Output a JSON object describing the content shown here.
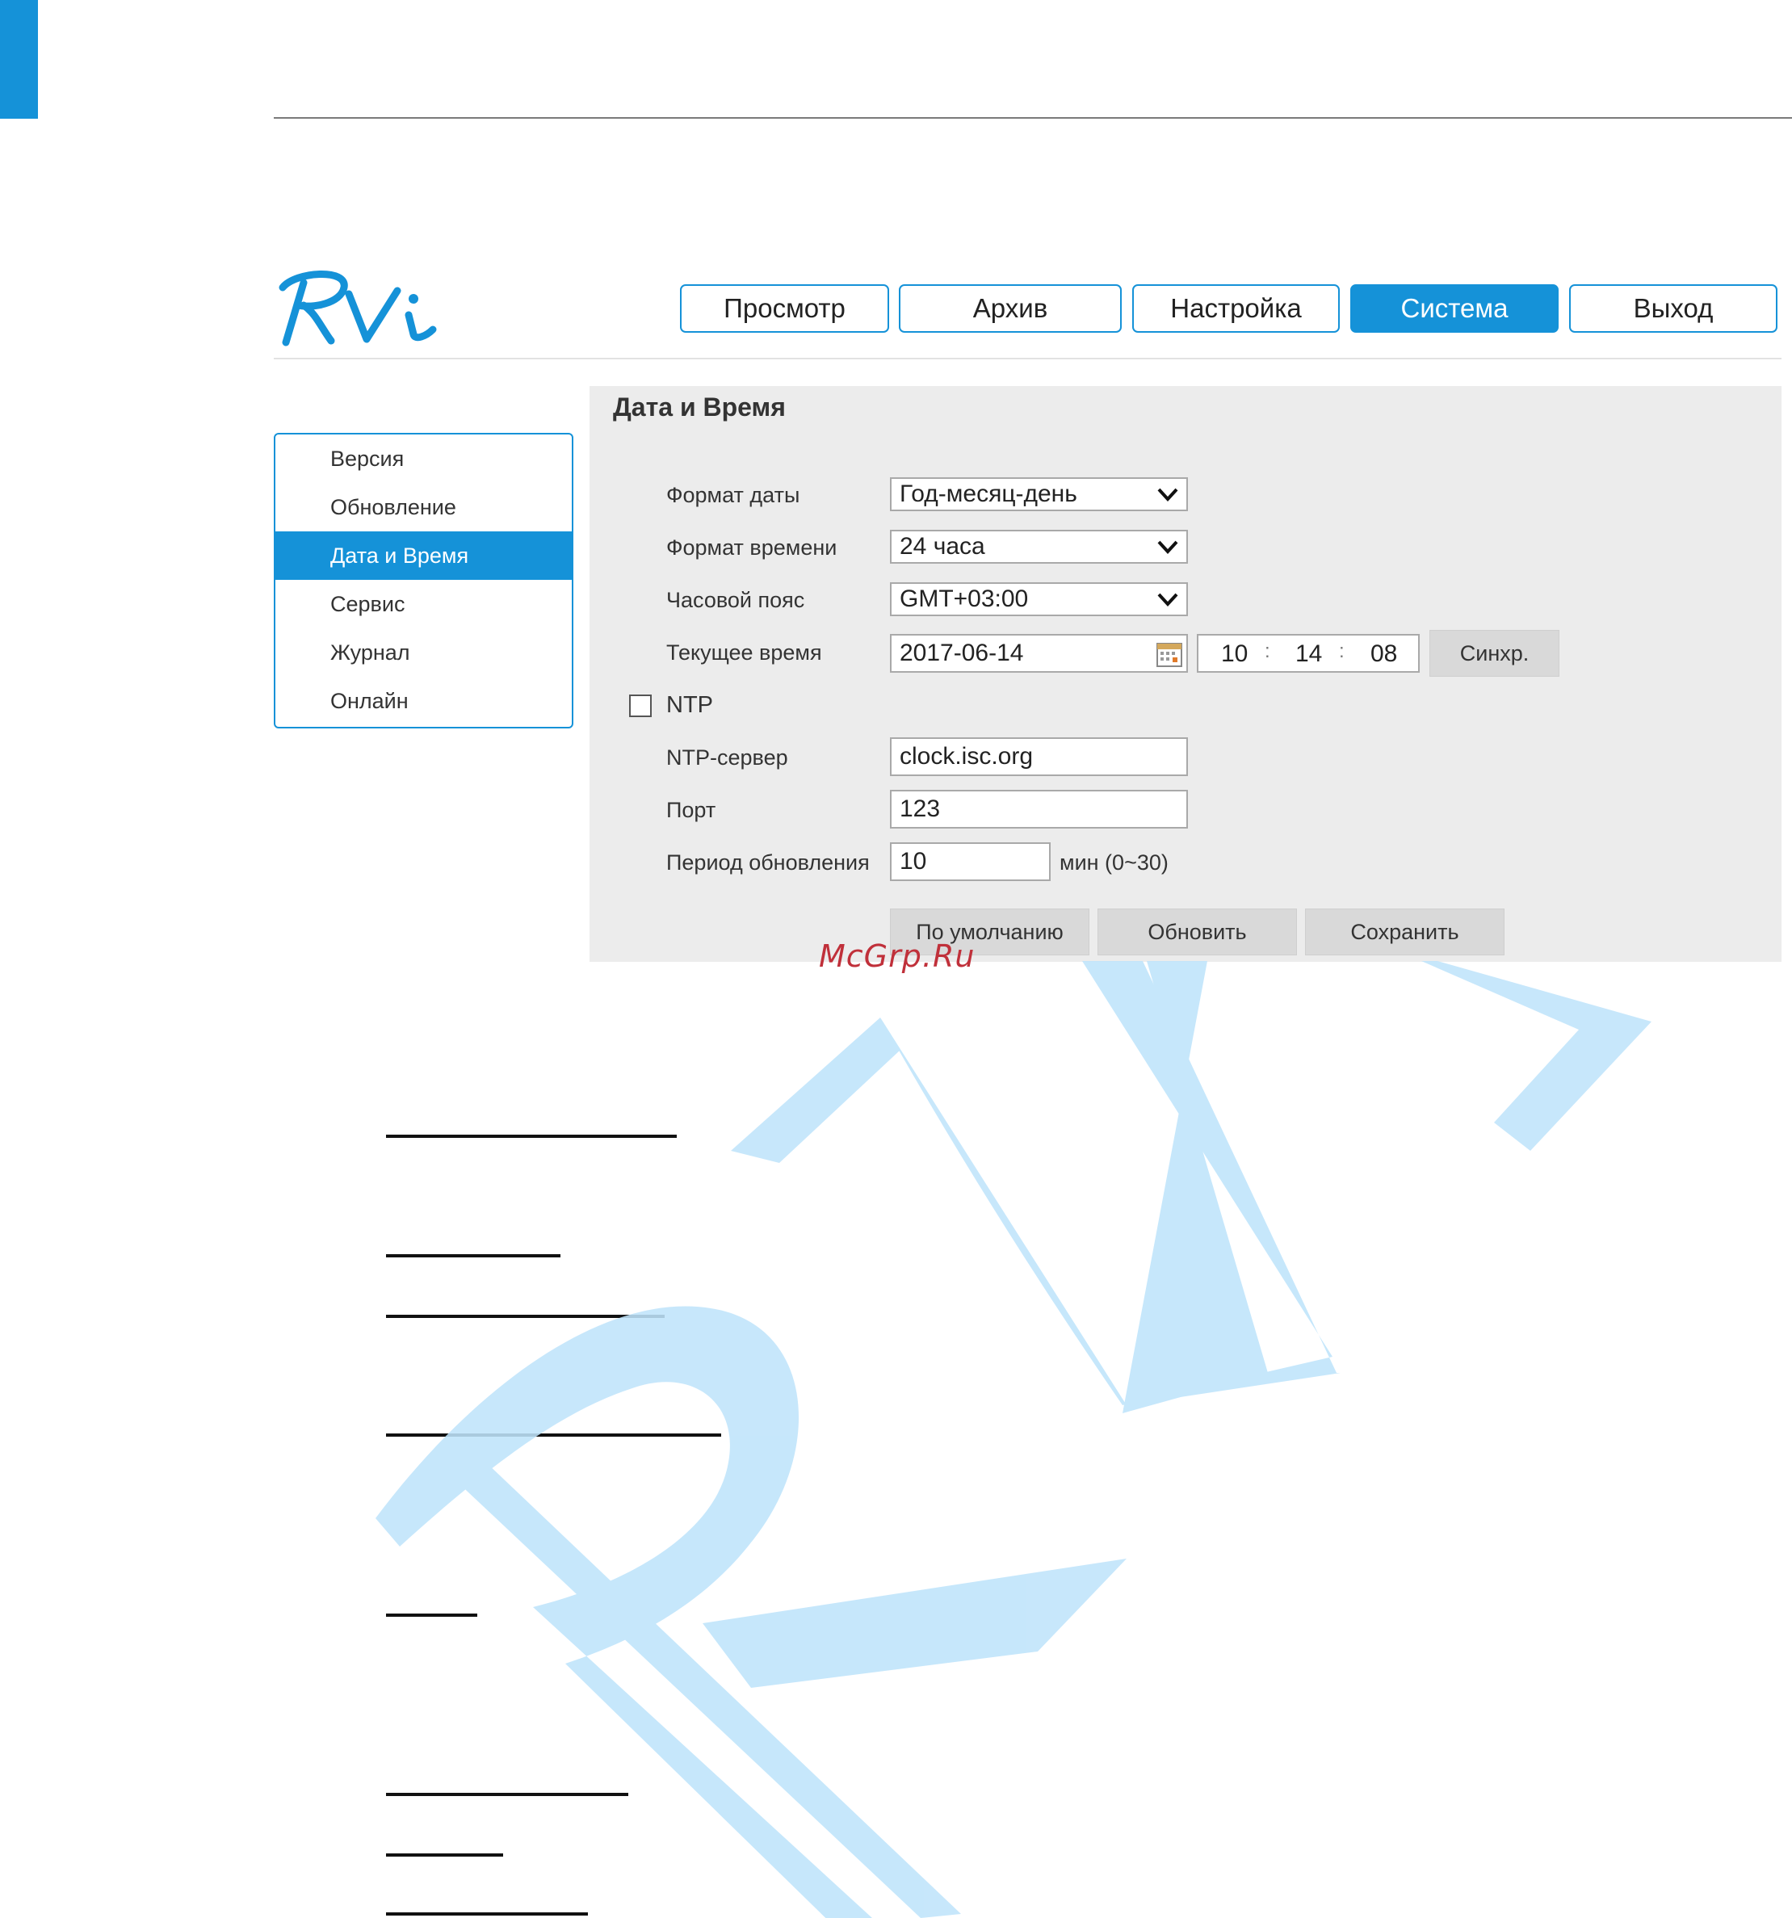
{
  "nav": {
    "tabs": [
      {
        "label": "Просмотр",
        "active": false
      },
      {
        "label": "Архив",
        "active": false
      },
      {
        "label": "Настройка",
        "active": false
      },
      {
        "label": "Система",
        "active": true
      },
      {
        "label": "Выход",
        "active": false
      }
    ]
  },
  "sidebar": {
    "items": [
      {
        "label": "Версия",
        "active": false
      },
      {
        "label": "Обновление",
        "active": false
      },
      {
        "label": "Дата и Время",
        "active": true
      },
      {
        "label": "Сервис",
        "active": false
      },
      {
        "label": "Журнал",
        "active": false
      },
      {
        "label": "Онлайн",
        "active": false
      }
    ]
  },
  "panel": {
    "title": "Дата и Время",
    "date_format": {
      "label": "Формат даты",
      "value": "Год-месяц-день"
    },
    "time_format": {
      "label": "Формат времени",
      "value": "24 часа"
    },
    "timezone": {
      "label": "Часовой пояс",
      "value": "GMT+03:00"
    },
    "current_time": {
      "label": "Текущее время",
      "date": "2017-06-14",
      "hours": "10",
      "minutes": "14",
      "seconds": "08",
      "sep": ":",
      "sync_label": "Синхр."
    },
    "ntp": {
      "label": "NTP",
      "checked": false
    },
    "ntp_server": {
      "label": "NTP-сервер",
      "value": "clock.isc.org"
    },
    "port": {
      "label": "Порт",
      "value": "123"
    },
    "update_period": {
      "label": "Период обновления",
      "value": "10",
      "unit": "мин (0~30)"
    },
    "buttons": {
      "default": "По умолчанию",
      "refresh": "Обновить",
      "save": "Сохранить"
    }
  },
  "watermark": {
    "text": "McGrp.Ru"
  },
  "colors": {
    "accent": "#1592d8",
    "watermark_logo": "#c9e8fb",
    "watermark_text": "#c0303a"
  }
}
